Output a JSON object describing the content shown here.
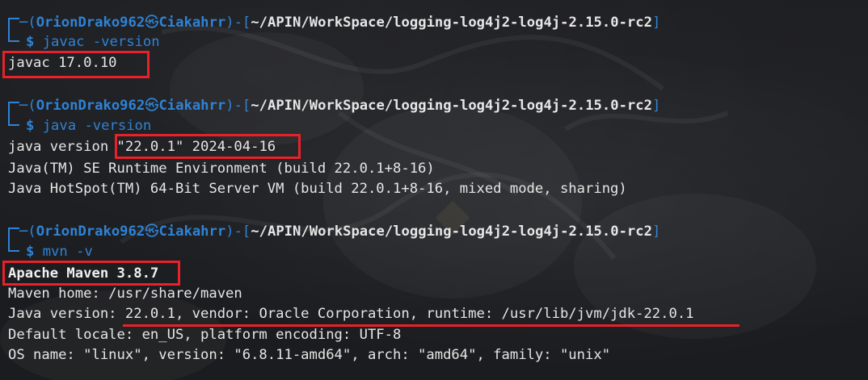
{
  "terminal": {
    "prompts": [
      {
        "user": "OrionDrako962",
        "at_symbol": "㉿",
        "host": "Ciakahrr",
        "path": "~/APIN/WorkSpace/logging-log4j2-log4j-2.15.0-rc2",
        "command": "javac",
        "argument": " -version"
      },
      {
        "user": "OrionDrako962",
        "at_symbol": "㉿",
        "host": "Ciakahrr",
        "path": "~/APIN/WorkSpace/logging-log4j2-log4j-2.15.0-rc2",
        "command": "java",
        "argument": " -version"
      },
      {
        "user": "OrionDrako962",
        "at_symbol": "㉿",
        "host": "Ciakahrr",
        "path": "~/APIN/WorkSpace/logging-log4j2-log4j-2.15.0-rc2",
        "command": "mvn",
        "argument": " -v"
      }
    ],
    "outputs": {
      "javac": [
        "javac 17.0.10"
      ],
      "java": {
        "version_prefix": "java version ",
        "version_highlight": "\"22.0.1\" 2024-04-16",
        "lines": [
          "Java(TM) SE Runtime Environment (build 22.0.1+8-16)",
          "Java HotSpot(TM) 64-Bit Server VM (build 22.0.1+8-16, mixed mode, sharing)"
        ]
      },
      "mvn": {
        "title": "Apache Maven 3.8.7",
        "home": "Maven home: /usr/share/maven",
        "java_prefix": "Java version:",
        "java_rest": " 22.0.1, vendor: Oracle Corporation, runtime: /usr/lib/jvm/jdk-22.0.1",
        "locale": "Default locale: en_US, platform encoding: UTF-8",
        "os": "OS name: \"linux\", version: \"6.8.11-amd64\", arch: \"amd64\", family: \"unix\""
      }
    },
    "prompt_parts": {
      "open": "─(",
      "close": ")-[",
      "end": "]",
      "dollar": "$ "
    }
  },
  "colors": {
    "background": "#1b1c1f",
    "prompt_blue": "#2f83d6",
    "text": "#e6e6e6",
    "highlight_red": "#e8212a"
  }
}
